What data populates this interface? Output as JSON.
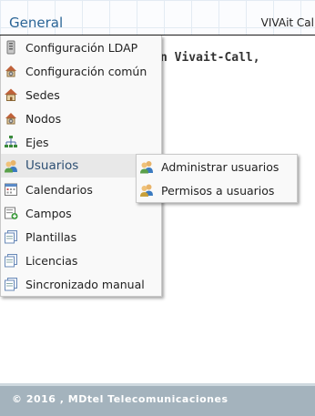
{
  "header": {
    "tab_label": "General",
    "brand": "VIVAit Cal"
  },
  "background_text": "n Vivait-Call,",
  "menu": {
    "items": [
      {
        "label": "Configuración LDAP",
        "icon": "database-icon"
      },
      {
        "label": "Configuración común",
        "icon": "home-gear-icon"
      },
      {
        "label": "Sedes",
        "icon": "home-icon"
      },
      {
        "label": "Nodos",
        "icon": "home-gear-icon"
      },
      {
        "label": "Ejes",
        "icon": "hierarchy-icon"
      },
      {
        "label": "Usuarios",
        "icon": "users-icon",
        "active": true
      },
      {
        "label": "Calendarios",
        "icon": "calendar-icon"
      },
      {
        "label": "Campos",
        "icon": "add-field-icon"
      },
      {
        "label": "Plantillas",
        "icon": "pages-icon"
      },
      {
        "label": "Licencias",
        "icon": "pages-icon"
      },
      {
        "label": "Sincronizado manual",
        "icon": "pages-icon"
      }
    ]
  },
  "submenu": {
    "items": [
      {
        "label": "Administrar usuarios",
        "icon": "users-icon"
      },
      {
        "label": "Permisos a usuarios",
        "icon": "users-key-icon"
      }
    ]
  },
  "footer": {
    "text": "© 2016 , MDtel Telecomunicaciones"
  }
}
